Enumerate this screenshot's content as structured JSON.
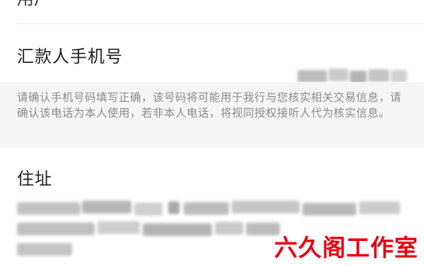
{
  "top_section": {
    "partial_label": "用户"
  },
  "phone_row": {
    "label": "汇款人手机号"
  },
  "notice": {
    "text": "请确认手机号码填写正确，该号码将可能用于我行与您核实相关交易信息，请确认该电话为本人使用，若非本人电话，将视同授权接听人代为核实信息。"
  },
  "address": {
    "label": "住址"
  },
  "watermark": {
    "text": "六久阁工作室"
  },
  "colors": {
    "notice_background": "#f5f5f5",
    "notice_text": "#8a8a8a",
    "watermark": "#e60012",
    "mask_gray": "#b8b8b8"
  }
}
